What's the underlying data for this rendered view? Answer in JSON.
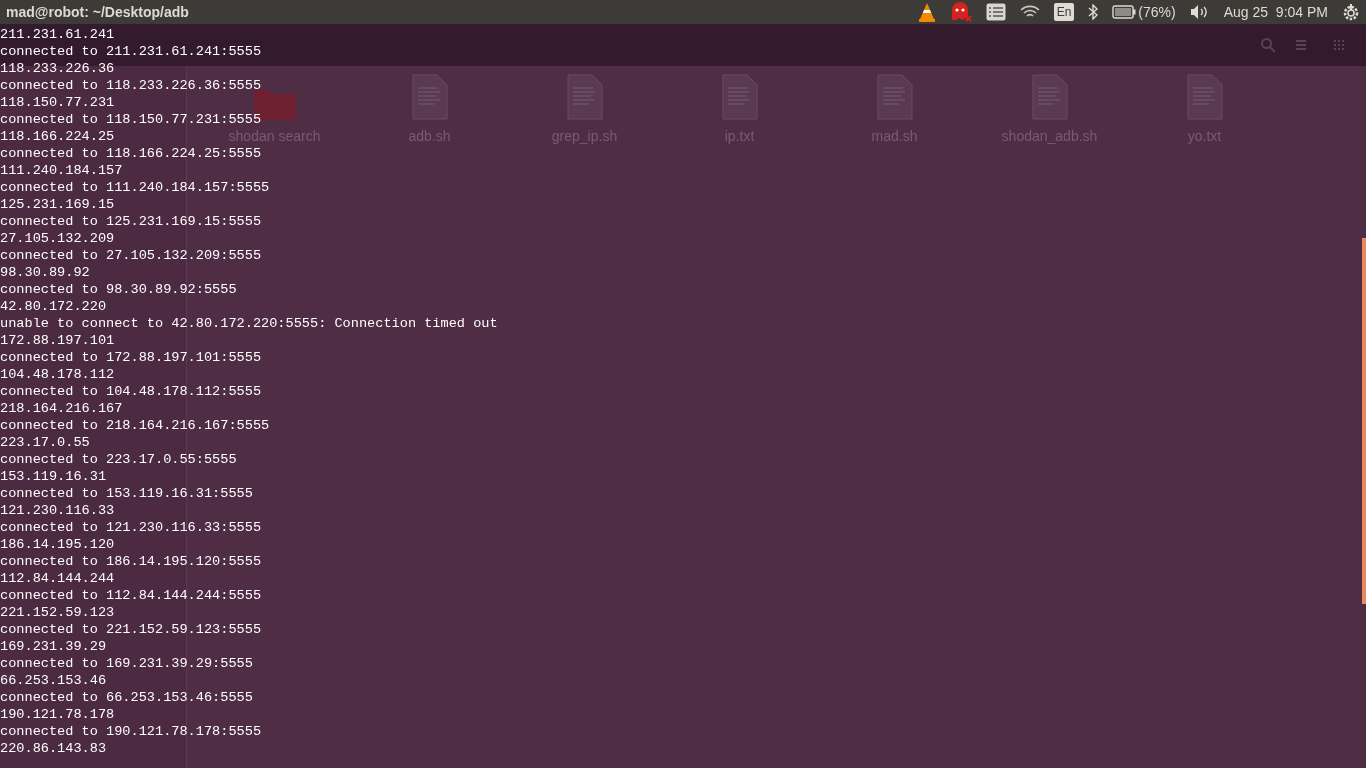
{
  "top_panel": {
    "title": "mad@robot: ~/Desktop/adb",
    "keyboard_layout": "En",
    "battery": "(76%)",
    "datetime": "Aug 25  9:04 PM"
  },
  "file_manager": {
    "files": [
      {
        "name": "shodan search",
        "kind": "folder"
      },
      {
        "name": "adb.sh",
        "kind": "file"
      },
      {
        "name": "grep_ip.sh",
        "kind": "file"
      },
      {
        "name": "ip.txt",
        "kind": "file"
      },
      {
        "name": "mad.sh",
        "kind": "file"
      },
      {
        "name": "shodan_adb.sh",
        "kind": "file"
      },
      {
        "name": "yo.txt",
        "kind": "file"
      }
    ]
  },
  "terminal": {
    "lines": [
      "211.231.61.241",
      "connected to 211.231.61.241:5555",
      "118.233.226.36",
      "connected to 118.233.226.36:5555",
      "118.150.77.231",
      "connected to 118.150.77.231:5555",
      "118.166.224.25",
      "connected to 118.166.224.25:5555",
      "111.240.184.157",
      "connected to 111.240.184.157:5555",
      "125.231.169.15",
      "connected to 125.231.169.15:5555",
      "27.105.132.209",
      "connected to 27.105.132.209:5555",
      "98.30.89.92",
      "connected to 98.30.89.92:5555",
      "42.80.172.220",
      "unable to connect to 42.80.172.220:5555: Connection timed out",
      "172.88.197.101",
      "connected to 172.88.197.101:5555",
      "104.48.178.112",
      "connected to 104.48.178.112:5555",
      "218.164.216.167",
      "connected to 218.164.216.167:5555",
      "223.17.0.55",
      "connected to 223.17.0.55:5555",
      "153.119.16.31",
      "connected to 153.119.16.31:5555",
      "121.230.116.33",
      "connected to 121.230.116.33:5555",
      "186.14.195.120",
      "connected to 186.14.195.120:5555",
      "112.84.144.244",
      "connected to 112.84.144.244:5555",
      "221.152.59.123",
      "connected to 221.152.59.123:5555",
      "169.231.39.29",
      "connected to 169.231.39.29:5555",
      "66.253.153.46",
      "connected to 66.253.153.46:5555",
      "190.121.78.178",
      "connected to 190.121.78.178:5555",
      "220.86.143.83"
    ]
  }
}
